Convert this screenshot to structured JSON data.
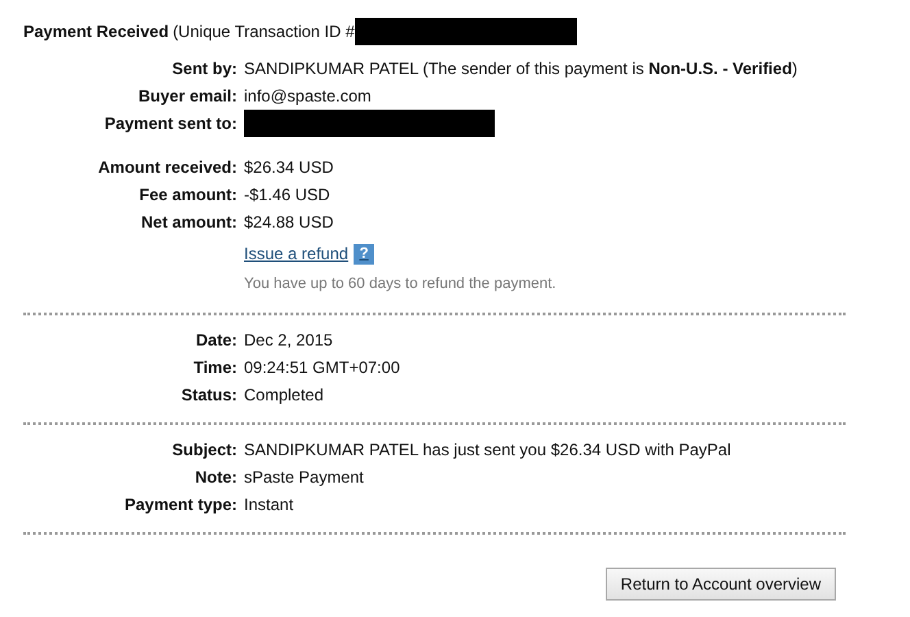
{
  "header": {
    "title": "Payment Received",
    "detail": "(Unique Transaction ID #",
    "redacted": true
  },
  "sections": [
    [
      [
        {
          "kind": "field",
          "label": "Sent by:",
          "value": "SANDIPKUMAR PATEL (The sender of this payment is **Non-U.S. - Verified**)"
        },
        {
          "kind": "field",
          "label": "Buyer email:",
          "value": "info@spaste.com"
        },
        {
          "kind": "field",
          "label": "Payment sent to:",
          "redacted": true
        }
      ],
      [
        {
          "kind": "field",
          "label": "Amount received:",
          "value": "$26.34 USD"
        },
        {
          "kind": "field",
          "label": "Fee amount:",
          "value": "-$1.46 USD"
        },
        {
          "kind": "field",
          "label": "Net amount:",
          "value": "$24.88 USD"
        },
        {
          "kind": "link",
          "value": "Issue a refund",
          "help": "?"
        },
        {
          "kind": "hint",
          "value": "You have up to 60 days to refund the payment."
        }
      ]
    ],
    [
      [
        {
          "kind": "field",
          "label": "Date:",
          "value": "Dec 2, 2015"
        },
        {
          "kind": "field",
          "label": "Time:",
          "value": "09:24:51 GMT+07:00"
        },
        {
          "kind": "field",
          "label": "Status:",
          "value": "Completed"
        }
      ]
    ],
    [
      [
        {
          "kind": "field",
          "label": "Subject:",
          "value": "SANDIPKUMAR PATEL has just sent you $26.34 USD with PayPal"
        },
        {
          "kind": "field",
          "label": "Note:",
          "value": "sPaste Payment"
        },
        {
          "kind": "field",
          "label": "Payment type:",
          "value": "Instant"
        }
      ]
    ]
  ],
  "button": "Return to Account overview"
}
